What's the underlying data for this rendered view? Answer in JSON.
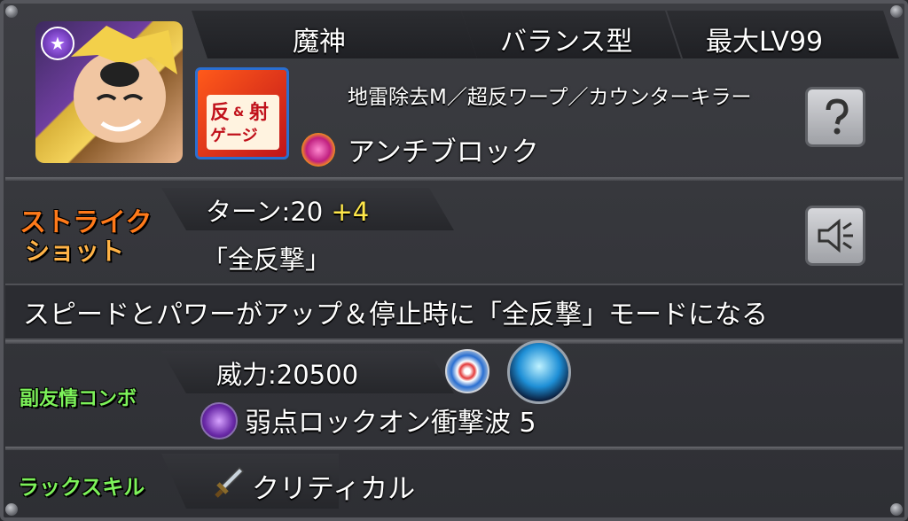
{
  "header": {
    "race": "魔神",
    "type": "バランス型",
    "max_level": "最大LV99"
  },
  "abilities": {
    "main": "地雷除去M／超反ワープ／カウンターキラー",
    "gauge_badge": {
      "line1": "反",
      "amp": "&",
      "line2": "射",
      "line3": "ゲージ"
    },
    "gauge_ability": "アンチブロック"
  },
  "strike_shot": {
    "label_line1": "ストライク",
    "label_line2": "ショット",
    "turns": "ターン:20",
    "turns_bonus": "+4",
    "name": "「全反撃」",
    "description": "スピードとパワーがアップ＆停止時に「全反撃」モードになる"
  },
  "sub_combo": {
    "label": "副友情コンボ",
    "power": "威力:20500",
    "name": "弱点ロックオン衝撃波 5"
  },
  "luck_skill": {
    "label": "ラックスキル",
    "name": "クリティカル"
  },
  "colors": {
    "strike_label": "#ff7a1a",
    "green_label": "#7df25a",
    "bonus": "#ffe84a"
  },
  "icons": [
    "dark-element-icon",
    "question-icon",
    "speaker-icon",
    "orb-icon",
    "blast-icon",
    "sword-icon"
  ]
}
